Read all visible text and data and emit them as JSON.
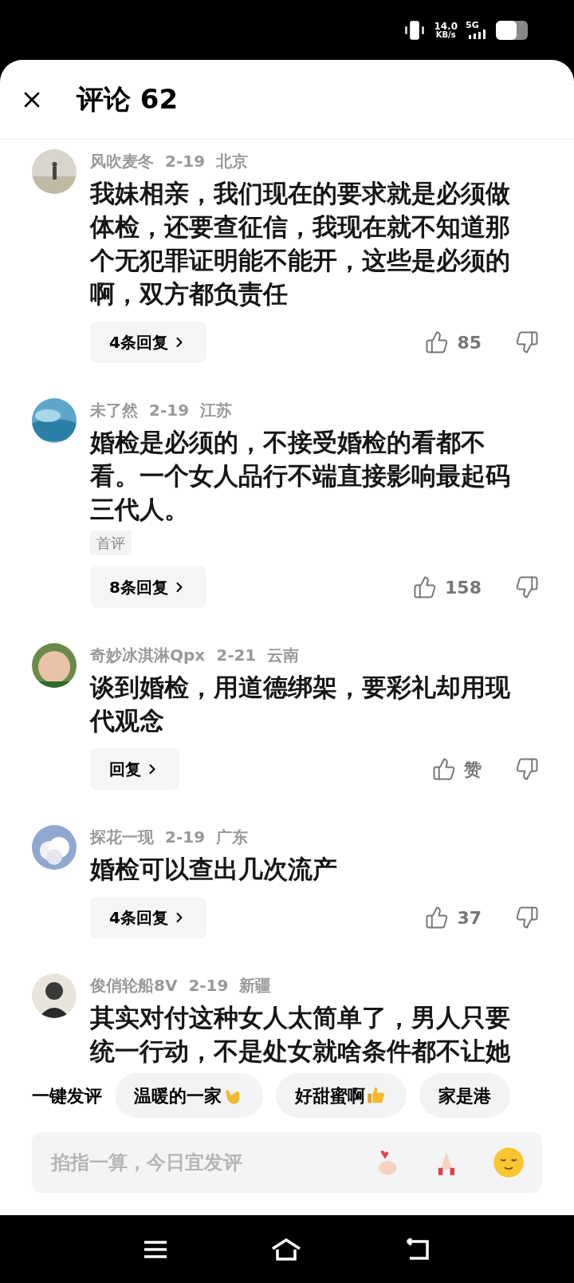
{
  "status_bar": {
    "speed": "14.0",
    "speed_unit": "KB/s",
    "network": "5G"
  },
  "header": {
    "title": "评论 62"
  },
  "comments": [
    {
      "name": "风吹麦冬",
      "date": "2-19",
      "location": "北京",
      "text": "我妹相亲，我们现在的要求就是必须做体检，还要查征信，我现在就不知道那个无犯罪证明能不能开，这些是必须的啊，双方都负责任",
      "reply_button": "4条回复",
      "likes": "85"
    },
    {
      "name": "未了然",
      "date": "2-19",
      "location": "江苏",
      "text": "婚检是必须的，不接受婚检的看都不看。一个女人品行不端直接影响最起码三代人。",
      "badge": "首评",
      "reply_button": "8条回复",
      "likes": "158"
    },
    {
      "name": "奇妙冰淇淋Qpx",
      "date": "2-21",
      "location": "云南",
      "text": "谈到婚检，用道德绑架，要彩礼却用现代观念",
      "reply_button": "回复",
      "likes": "赞"
    },
    {
      "name": "探花一现",
      "date": "2-19",
      "location": "广东",
      "text": "婚检可以查出几次流产",
      "reply_button": "4条回复",
      "likes": "37"
    },
    {
      "name": "俊俏轮船8V",
      "date": "2-19",
      "location": "新疆",
      "text": "其实对付这种女人太简单了，男人只要统一行动，不是处女就啥条件都不让她"
    }
  ],
  "quick_comments": {
    "label": "一键发评",
    "chips": [
      {
        "text": "温暖的一家"
      },
      {
        "text": "好甜蜜啊"
      },
      {
        "text": "家是港"
      }
    ]
  },
  "input": {
    "placeholder": "掐指一算，今日宜发评"
  }
}
